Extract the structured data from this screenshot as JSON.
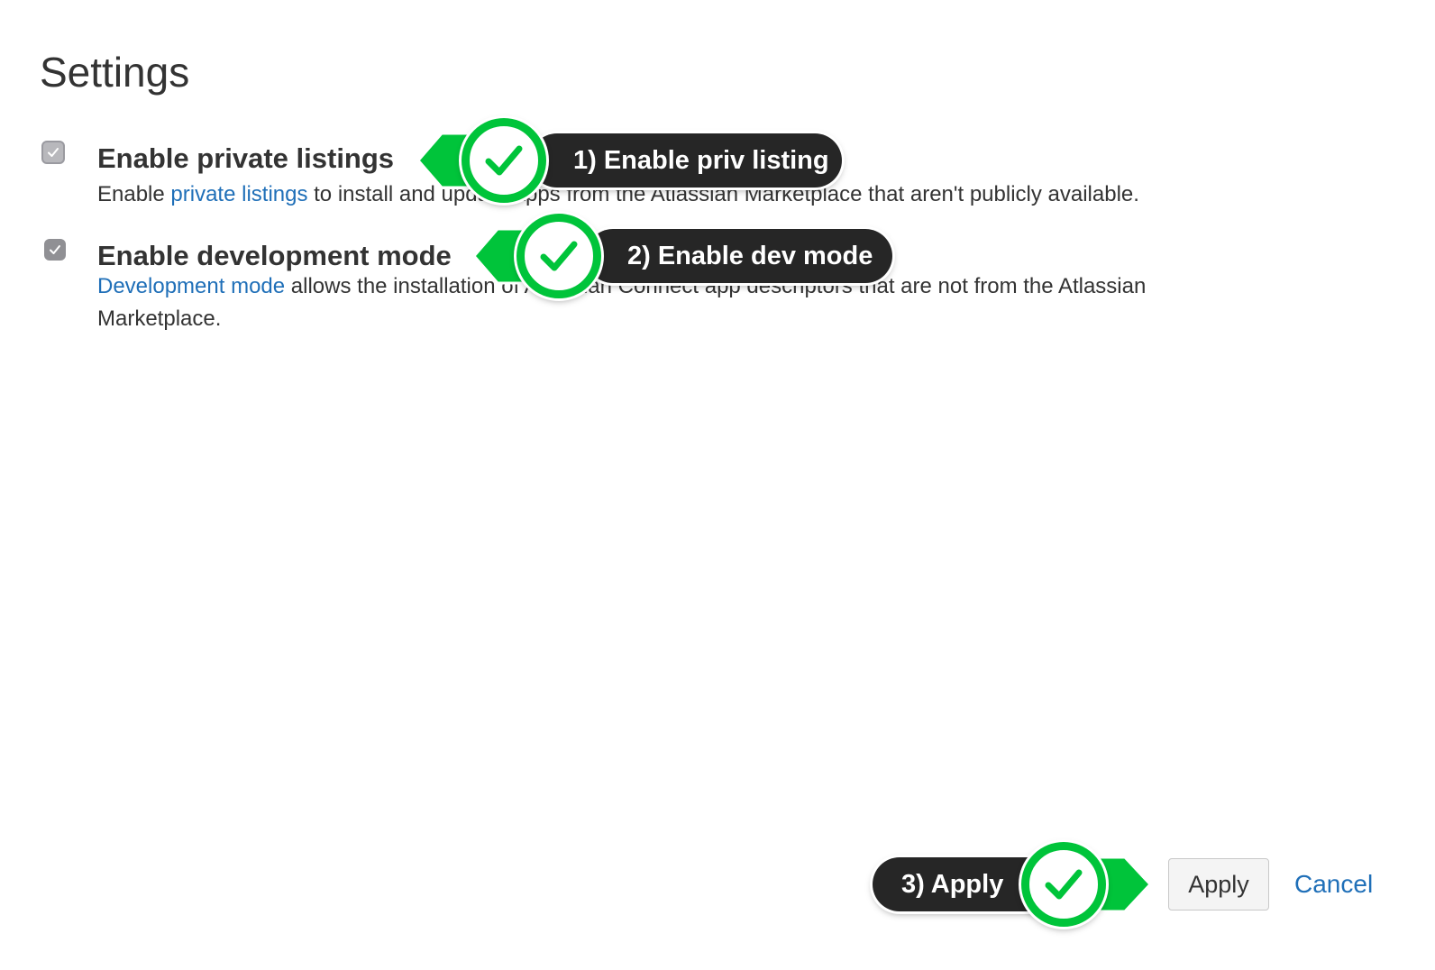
{
  "page": {
    "title": "Settings"
  },
  "settings": [
    {
      "label": "Enable private listings",
      "checked": true,
      "desc_link": "private listings",
      "desc_before": "Enable ",
      "desc_after": " to install and update apps from the Atlassian Marketplace that aren't publicly available."
    },
    {
      "label": "Enable development mode",
      "checked": true,
      "desc_link": "Development mode",
      "desc_before": "",
      "desc_after": " allows the installation of Atlassian Connect app descriptors that are not from the Atlassian Marketplace."
    }
  ],
  "footer": {
    "apply_label": "Apply",
    "cancel_label": "Cancel"
  },
  "annotations": [
    {
      "step": "1) Enable priv listing"
    },
    {
      "step": "2) Enable dev mode"
    },
    {
      "step": "3) Apply"
    }
  ],
  "colors": {
    "link": "#1f6fb8",
    "annotation_green": "#00c43a",
    "annotation_pill": "#262626",
    "checkbox": "#909094"
  },
  "icons": {
    "checkbox": "checkmark-icon",
    "annotation": "green-checkmark-icon"
  }
}
